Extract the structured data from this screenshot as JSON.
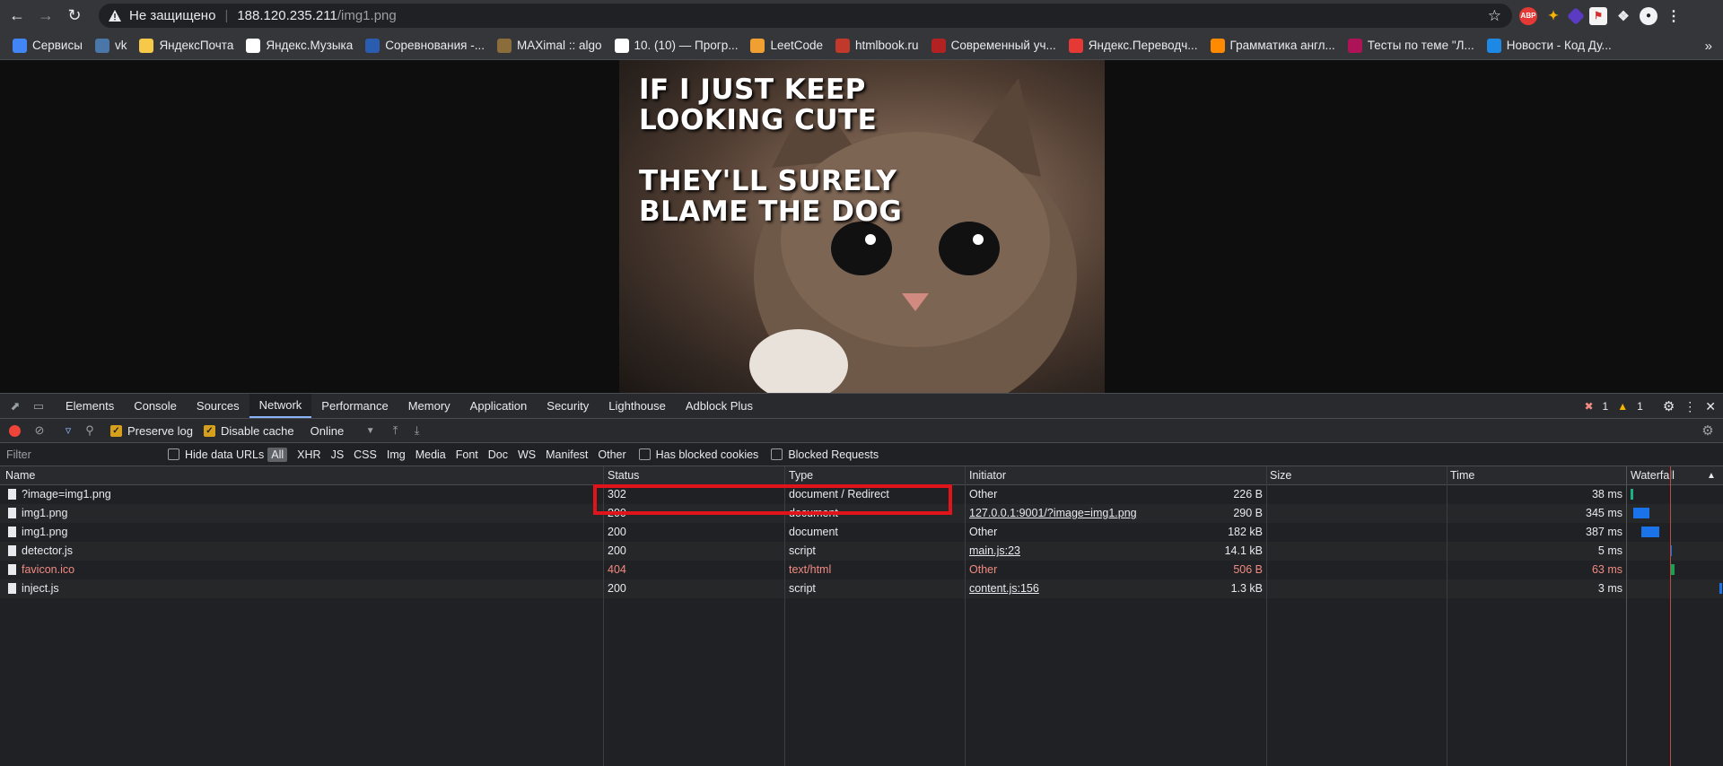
{
  "browser": {
    "address": {
      "not_secure": "Не защищено",
      "host": "188.120.235.211",
      "path": "/img1.png"
    },
    "extensions": [
      "ABP",
      "puzzle",
      "pen",
      "flag",
      "extensions-icon",
      "profile"
    ],
    "bookmarks": [
      {
        "label": "Сервисы",
        "color": "#4285f4"
      },
      {
        "label": "vk",
        "color": "#4a76a8"
      },
      {
        "label": "ЯндексПочта",
        "color": "#f7c948"
      },
      {
        "label": "Яндекс.Музыка",
        "color": "#ffffff"
      },
      {
        "label": "Соревнования -...",
        "color": "#2a5db0"
      },
      {
        "label": "MAXimal :: algo",
        "color": "#8a6d3b"
      },
      {
        "label": "10. (10) — Прогр...",
        "color": "#ffffff"
      },
      {
        "label": "LeetCode",
        "color": "#f0a030"
      },
      {
        "label": "htmlbook.ru",
        "color": "#c0392b"
      },
      {
        "label": "Современный уч...",
        "color": "#b22222"
      },
      {
        "label": "Яндекс.Переводч...",
        "color": "#e53935"
      },
      {
        "label": "Грамматика англ...",
        "color": "#ff8a00"
      },
      {
        "label": "Тесты по теме \"Л...",
        "color": "#ad1457"
      },
      {
        "label": "Новости - Код Ду...",
        "color": "#1e88e5"
      }
    ]
  },
  "image": {
    "line1": "IF I JUST KEEP",
    "line2": "LOOKING CUTE",
    "line3": "THEY'LL SURELY",
    "line4": "BLAME THE DOG"
  },
  "devtools": {
    "tabs": [
      "Elements",
      "Console",
      "Sources",
      "Network",
      "Performance",
      "Memory",
      "Application",
      "Security",
      "Lighthouse",
      "Adblock Plus"
    ],
    "active_tab": "Network",
    "errors": "1",
    "warnings": "1",
    "toolbar": {
      "preserve_log": "Preserve log",
      "disable_cache": "Disable cache",
      "throttle": "Online"
    },
    "filter": {
      "placeholder": "Filter",
      "hide_data_urls": "Hide data URLs",
      "types": [
        "All",
        "XHR",
        "JS",
        "CSS",
        "Img",
        "Media",
        "Font",
        "Doc",
        "WS",
        "Manifest",
        "Other"
      ],
      "has_blocked": "Has blocked cookies",
      "blocked_requests": "Blocked Requests"
    },
    "columns": {
      "name": "Name",
      "status": "Status",
      "type": "Type",
      "initiator": "Initiator",
      "size": "Size",
      "time": "Time",
      "waterfall": "Waterfall"
    },
    "rows": [
      {
        "name": "?image=img1.png",
        "status": "302",
        "type": "document / Redirect",
        "initiator": "Other",
        "size": "226 B",
        "time": "38 ms"
      },
      {
        "name": "img1.png",
        "status": "200",
        "type": "document",
        "initiator": "127.0.0.1:9001/?image=img1.png",
        "size": "290 B",
        "time": "345 ms"
      },
      {
        "name": "img1.png",
        "status": "200",
        "type": "document",
        "initiator": "Other",
        "size": "182 kB",
        "time": "387 ms"
      },
      {
        "name": "detector.js",
        "status": "200",
        "type": "script",
        "initiator": "main.js:23",
        "size": "14.1 kB",
        "time": "5 ms"
      },
      {
        "name": "favicon.ico",
        "status": "404",
        "type": "text/html",
        "initiator": "Other",
        "size": "506 B",
        "time": "63 ms"
      },
      {
        "name": "inject.js",
        "status": "200",
        "type": "script",
        "initiator": "content.js:156",
        "size": "1.3 kB",
        "time": "3 ms"
      }
    ]
  }
}
